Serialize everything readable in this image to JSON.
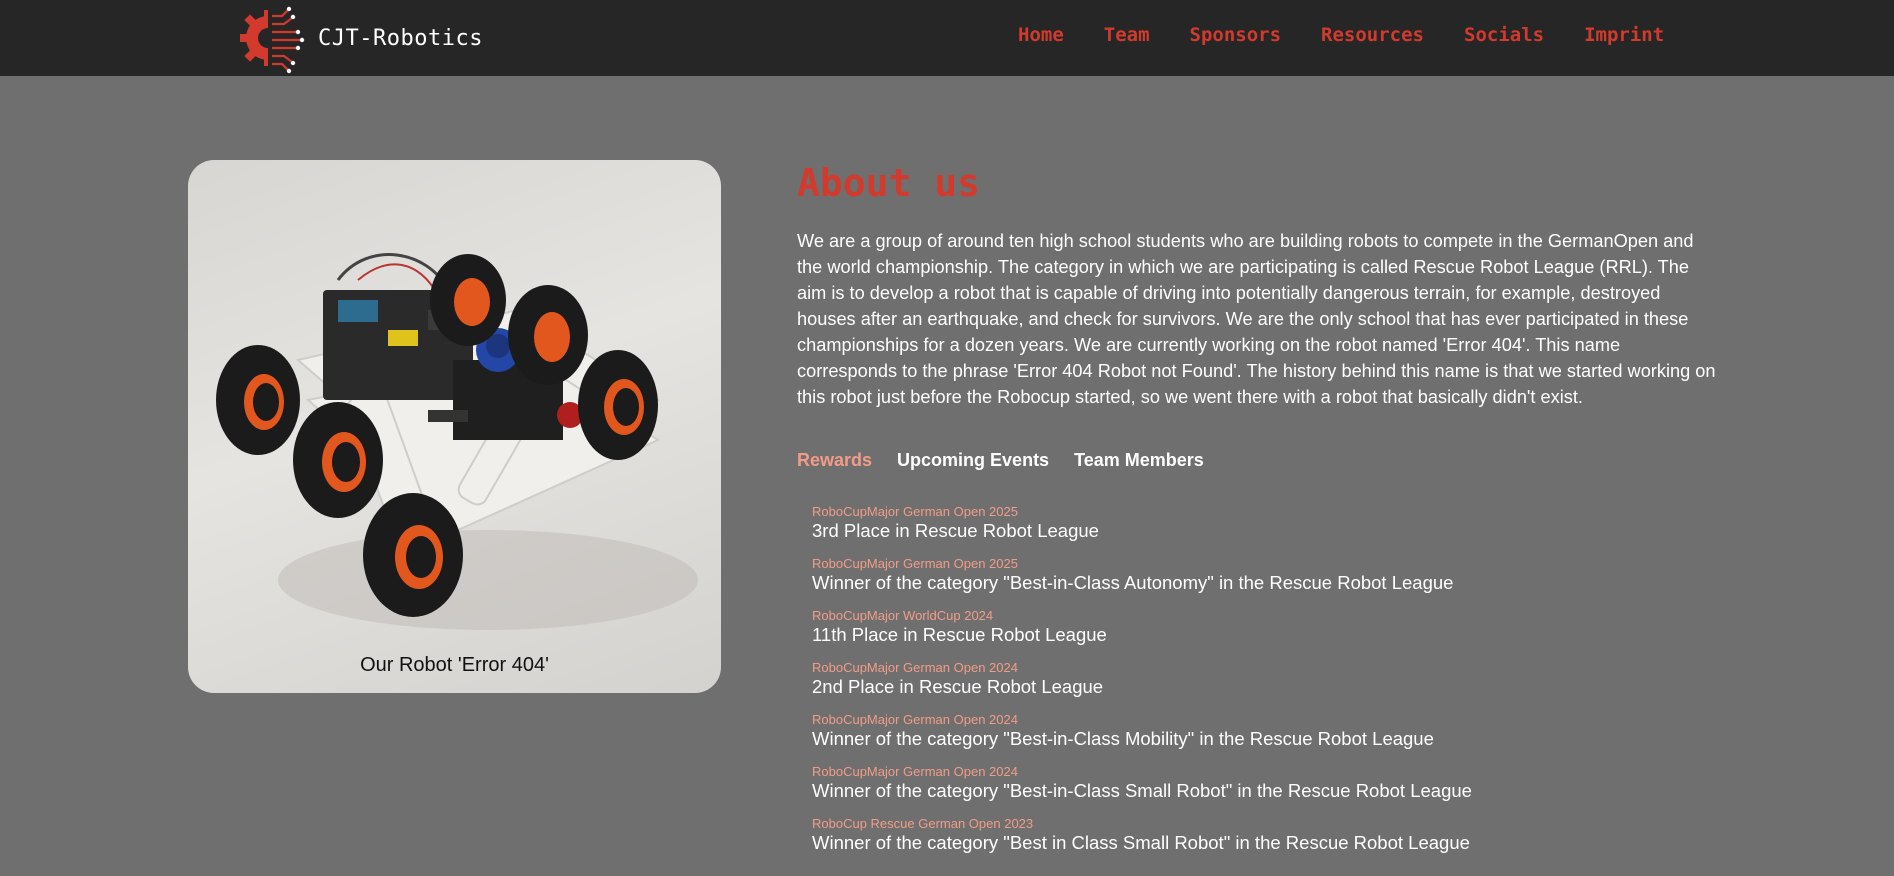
{
  "brand": {
    "name": "CJT-Robotics",
    "logo_icon": "gear-circuit-logo-icon",
    "accent": "#d23a2d"
  },
  "nav": {
    "items": [
      {
        "label": "Home"
      },
      {
        "label": "Team"
      },
      {
        "label": "Sponsors"
      },
      {
        "label": "Resources"
      },
      {
        "label": "Socials"
      },
      {
        "label": "Imprint"
      }
    ]
  },
  "robot_card": {
    "caption": "Our Robot 'Error 404'"
  },
  "about": {
    "title": "About us",
    "text": "We are a group of around ten high school students who are building robots to compete in the GermanOpen and the world championship. The category in which we are participating is called Rescue Robot League (RRL). The aim is to develop a robot that is capable of driving into potentially dangerous terrain, for example, destroyed houses after an earthquake, and check for survivors. We are the only school that has ever participated in these championships for a dozen years. We are currently working on the robot named 'Error 404'. This name corresponds to the phrase 'Error 404 Robot not Found'. The history behind this name is that we started working on this robot just before the Robocup started, so we went there with a robot that basically didn't exist."
  },
  "tabs": [
    {
      "label": "Rewards",
      "active": true
    },
    {
      "label": "Upcoming Events",
      "active": false
    },
    {
      "label": "Team Members",
      "active": false
    }
  ],
  "rewards": [
    {
      "event": "RoboCupMajor German Open 2025",
      "title": "3rd Place in Rescue Robot League"
    },
    {
      "event": "RoboCupMajor German Open 2025",
      "title": "Winner of the category \"Best-in-Class Autonomy\" in the Rescue Robot League"
    },
    {
      "event": "RoboCupMajor WorldCup 2024",
      "title": "11th Place in Rescue Robot League"
    },
    {
      "event": "RoboCupMajor German Open 2024",
      "title": "2nd Place in Rescue Robot League"
    },
    {
      "event": "RoboCupMajor German Open 2024",
      "title": "Winner of the category \"Best-in-Class Mobility\" in the Rescue Robot League"
    },
    {
      "event": "RoboCupMajor German Open 2024",
      "title": "Winner of the category \"Best-in-Class Small Robot\" in the Rescue Robot League"
    },
    {
      "event": "RoboCup Rescue German Open 2023",
      "title": "Winner of the category \"Best in Class Small Robot\" in the Rescue Robot League"
    }
  ],
  "colors": {
    "nav_background": "#262626",
    "page_background": "#6f6f6f",
    "accent_red": "#d23a2d",
    "accent_salmon": "#f29c88"
  }
}
